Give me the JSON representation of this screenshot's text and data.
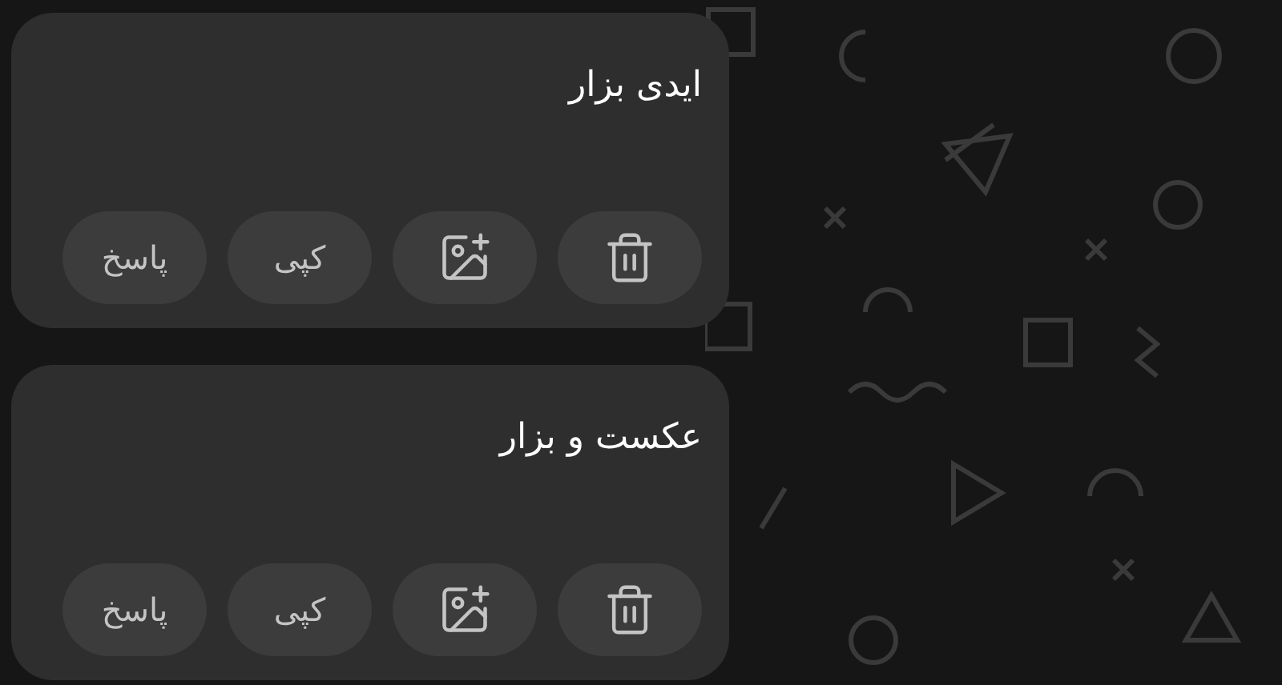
{
  "messages": [
    {
      "text": "ایدی بزار",
      "actions": [
        {
          "kind": "delete"
        },
        {
          "kind": "add-image"
        },
        {
          "kind": "text",
          "label": "کپی"
        },
        {
          "kind": "text",
          "label": "پاسخ"
        }
      ]
    },
    {
      "text": "عکست و بزار",
      "actions": [
        {
          "kind": "delete"
        },
        {
          "kind": "add-image"
        },
        {
          "kind": "text",
          "label": "کپی"
        },
        {
          "kind": "text",
          "label": "پاسخ"
        }
      ]
    }
  ]
}
